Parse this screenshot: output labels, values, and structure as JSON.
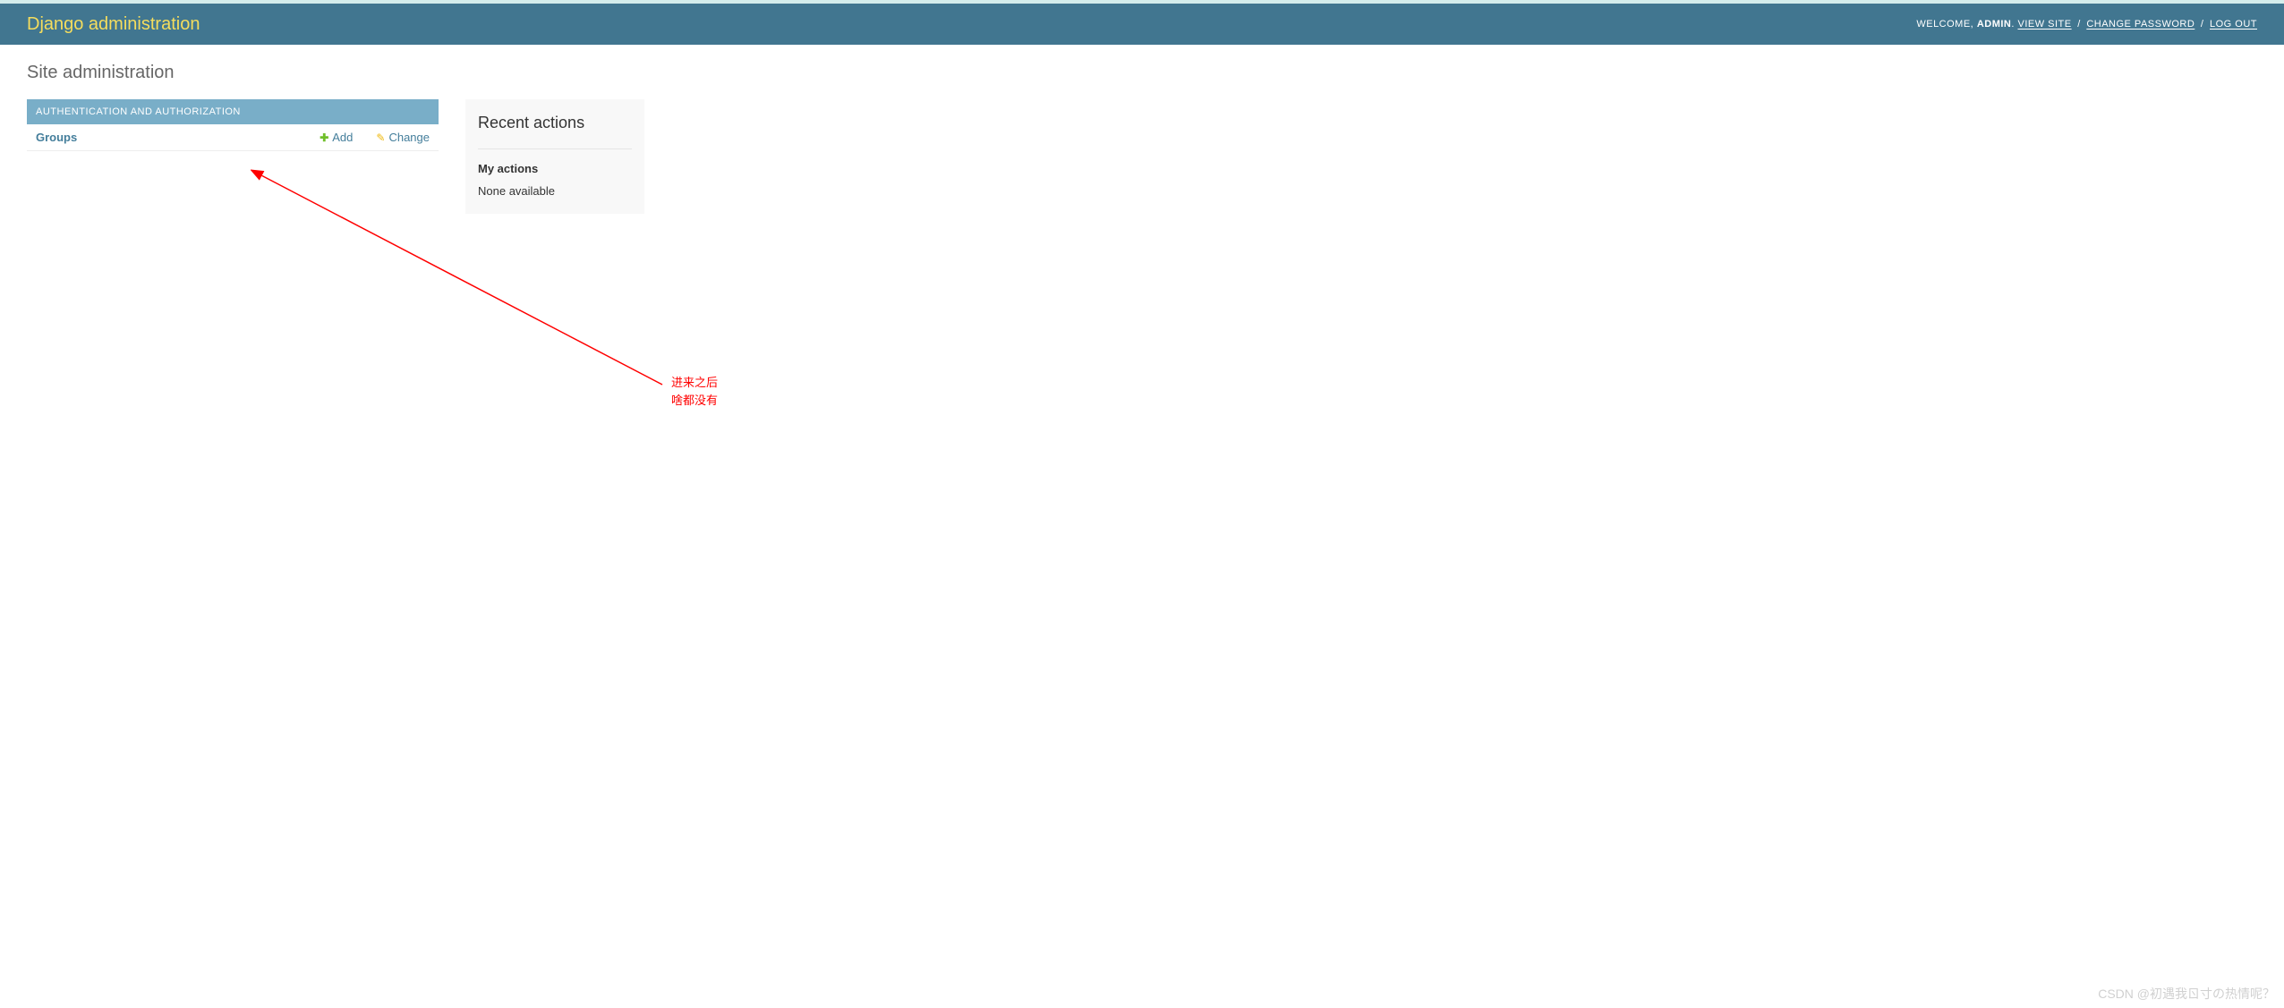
{
  "header": {
    "branding": "Django administration",
    "welcome": "WELCOME,",
    "username": "ADMIN",
    "view_site": "VIEW SITE",
    "change_password": "CHANGE PASSWORD",
    "log_out": "LOG OUT",
    "sep_dot": ".",
    "sep_slash": "/"
  },
  "page": {
    "title": "Site administration"
  },
  "apps": [
    {
      "caption": "AUTHENTICATION AND AUTHORIZATION",
      "models": [
        {
          "name": "Groups",
          "add_label": "Add",
          "change_label": "Change"
        }
      ]
    }
  ],
  "sidebar": {
    "recent_title": "Recent actions",
    "my_actions": "My actions",
    "none": "None available"
  },
  "annotation": {
    "line1": "进来之后",
    "line2": "啥都没有"
  },
  "watermark": "CSDN @初遇我ㄖ寸の热情呢？"
}
